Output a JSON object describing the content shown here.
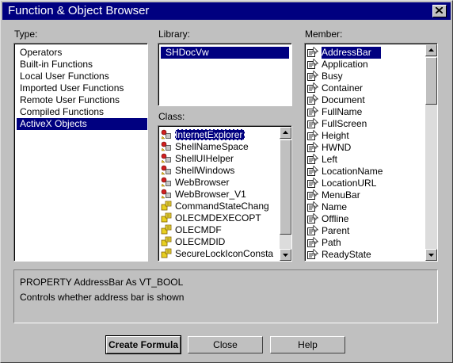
{
  "window": {
    "title": "Function & Object Browser"
  },
  "type_panel": {
    "label": "Type:",
    "items": [
      "Operators",
      "Built-in Functions",
      "Local User Functions",
      "Imported User Functions",
      "Remote User Functions",
      "Compiled Functions",
      "ActiveX Objects"
    ],
    "selected_index": 6
  },
  "library_panel": {
    "label": "Library:",
    "items": [
      "SHDocVw"
    ],
    "selected_index": 0
  },
  "class_panel": {
    "label": "Class:",
    "items": [
      {
        "label": "InternetExplorer",
        "icon": "class-object-icon"
      },
      {
        "label": "ShellNameSpace",
        "icon": "class-object-icon"
      },
      {
        "label": "ShellUIHelper",
        "icon": "class-object-icon"
      },
      {
        "label": "ShellWindows",
        "icon": "class-object-icon"
      },
      {
        "label": "WebBrowser",
        "icon": "class-object-icon"
      },
      {
        "label": "WebBrowser_V1",
        "icon": "class-object-icon"
      },
      {
        "label": "CommandStateChang",
        "icon": "enum-icon"
      },
      {
        "label": "OLECMDEXECOPT",
        "icon": "enum-icon"
      },
      {
        "label": "OLECMDF",
        "icon": "enum-icon"
      },
      {
        "label": "OLECMDID",
        "icon": "enum-icon"
      },
      {
        "label": "SecureLockIconConsta",
        "icon": "enum-icon"
      }
    ],
    "selected_index": 0
  },
  "member_panel": {
    "label": "Member:",
    "items": [
      "AddressBar",
      "Application",
      "Busy",
      "Container",
      "Document",
      "FullName",
      "FullScreen",
      "Height",
      "HWND",
      "Left",
      "LocationName",
      "LocationURL",
      "MenuBar",
      "Name",
      "Offline",
      "Parent",
      "Path",
      "ReadyState"
    ],
    "icon": "property-icon",
    "selected_index": 0
  },
  "description": {
    "signature": "PROPERTY AddressBar As VT_BOOL",
    "text": "Controls whether address bar is shown"
  },
  "buttons": {
    "create_formula": "Create Formula",
    "close": "Close",
    "help": "Help"
  },
  "colors": {
    "title_bar": "#000080",
    "selection": "#000080",
    "face": "#c0c0c0"
  }
}
